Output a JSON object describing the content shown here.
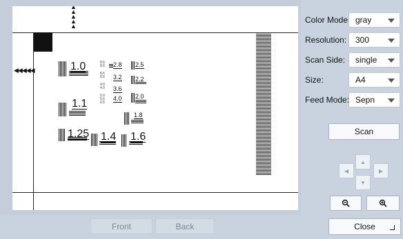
{
  "preview": {
    "chart_labels": [
      "1.0",
      "1.1",
      "1.25",
      "1.4",
      "1.6",
      "2.8",
      "3.2",
      "3.6",
      "4.0",
      "2.5",
      "2.2",
      "2.0",
      "1.8"
    ]
  },
  "bottom_bar": {
    "front_label": "Front",
    "back_label": "Back",
    "close_label": "Close"
  },
  "settings": {
    "color_mode_label": "Color Mode:",
    "color_mode_value": "gray",
    "resolution_label": "Resolution:",
    "resolution_value": "300",
    "scan_side_label": "Scan Side:",
    "scan_side_value": "single",
    "size_label": "Size:",
    "size_value": "A4",
    "feed_mode_label": "Feed Mode:",
    "feed_mode_value": "Sepn"
  },
  "actions": {
    "scan_label": "Scan"
  },
  "icons": {
    "pan_up": "triangle-up-icon",
    "pan_down": "triangle-down-icon",
    "pan_left": "triangle-left-icon",
    "pan_right": "triangle-right-icon",
    "zoom_out": "zoom-out-icon",
    "zoom_in": "zoom-in-icon"
  },
  "colors": {
    "panel_bg": "#c9d3df",
    "button_bg": "#f7f9fb",
    "disabled_text": "#7d8794"
  }
}
